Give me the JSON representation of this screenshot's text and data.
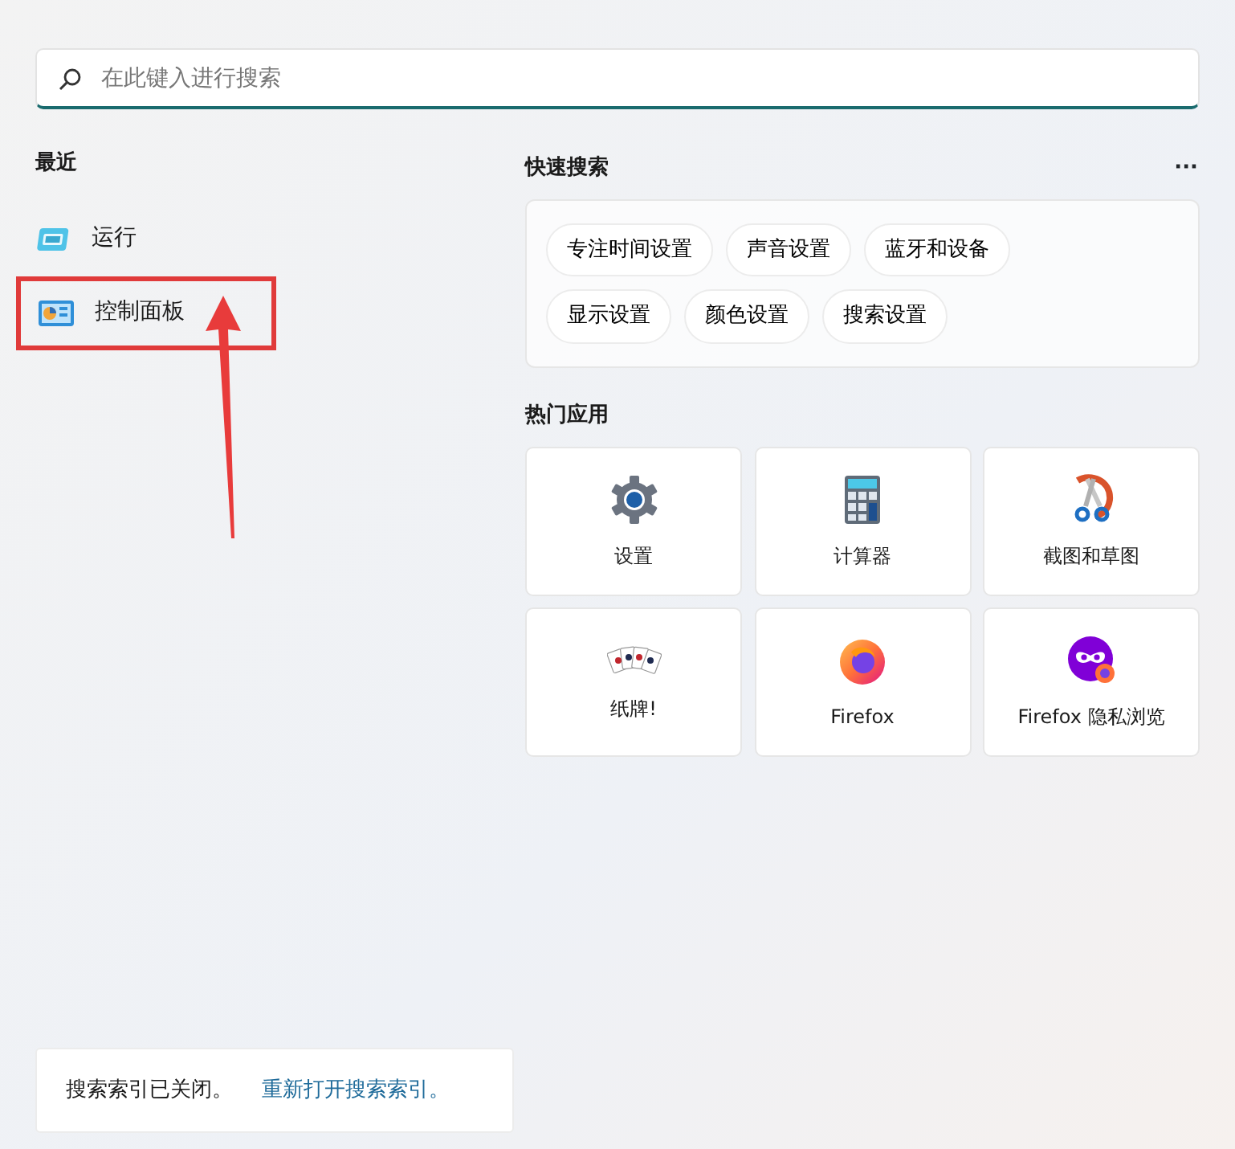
{
  "search": {
    "placeholder": "在此键入进行搜索"
  },
  "recent": {
    "title": "最近",
    "items": [
      {
        "label": "运行",
        "kind": "run",
        "highlighted": false
      },
      {
        "label": "控制面板",
        "kind": "panel",
        "highlighted": true
      }
    ]
  },
  "quick_search": {
    "title": "快速搜索",
    "more": "···",
    "chips": [
      "专注时间设置",
      "声音设置",
      "蓝牙和设备",
      "显示设置",
      "颜色设置",
      "搜索设置"
    ]
  },
  "top_apps": {
    "title": "热门应用",
    "apps": [
      {
        "label": "设置",
        "kind": "settings"
      },
      {
        "label": "计算器",
        "kind": "calculator"
      },
      {
        "label": "截图和草图",
        "kind": "snipping"
      },
      {
        "label": "纸牌!",
        "kind": "cards"
      },
      {
        "label": "Firefox",
        "kind": "browser"
      },
      {
        "label": "Firefox 隐私浏览",
        "kind": "private"
      }
    ]
  },
  "notice": {
    "text": "搜索索引已关闭。",
    "link": "重新打开搜索索引。"
  }
}
